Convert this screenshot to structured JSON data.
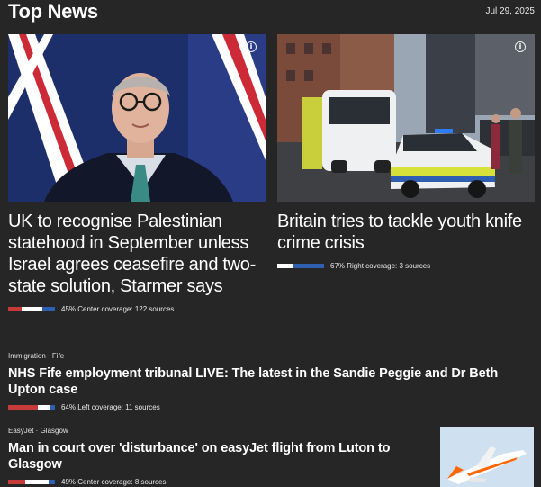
{
  "header": {
    "title": "Top News",
    "date": "Jul 29, 2025"
  },
  "hero_stories": [
    {
      "title": "UK to recognise Palestinian statehood in September unless Israel agrees ceasefire and two-state solution, Starmer says",
      "coverage_text": "45% Center coverage: 122 sources",
      "bias": {
        "left": 0.28,
        "center": 0.45,
        "right": 0.27
      }
    },
    {
      "title": "Britain tries to tackle youth knife crime crisis",
      "coverage_text": "67% Right coverage: 3 sources",
      "bias": {
        "left": 0.0,
        "center": 0.33,
        "right": 0.67
      }
    }
  ],
  "stories": [
    {
      "tags": "Immigration · Fife",
      "title": "NHS Fife employment tribunal LIVE: The latest in the Sandie Peggie and Dr Beth Upton case",
      "coverage_text": "64% Left coverage: 11 sources",
      "bias": {
        "left": 0.64,
        "center": 0.27,
        "right": 0.09
      }
    },
    {
      "tags": "EasyJet · Glasgow",
      "title": "Man in court over 'disturbance' on easyJet flight from Luton to Glasgow",
      "coverage_text": "49% Center coverage: 8 sources",
      "bias": {
        "left": 0.37,
        "center": 0.49,
        "right": 0.14
      }
    }
  ],
  "colors": {
    "left": "#c63a3a",
    "center": "#ffffff",
    "right": "#2f5fb1",
    "background": "#262626"
  },
  "icons": {
    "info": "info-icon"
  }
}
